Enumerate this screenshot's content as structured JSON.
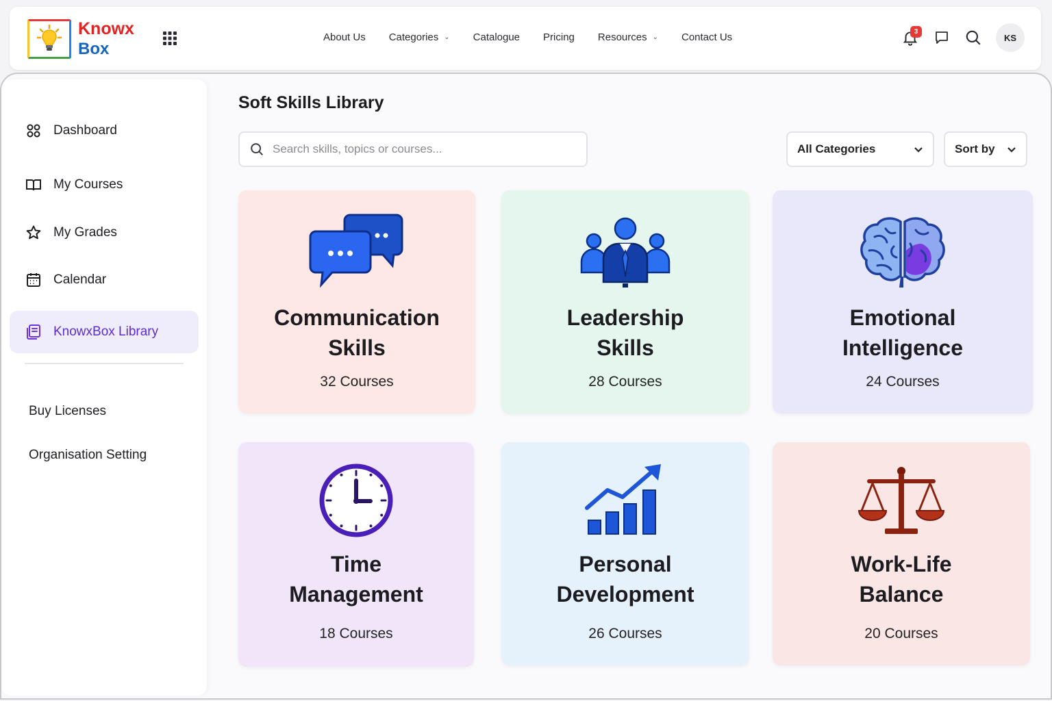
{
  "brand": {
    "name_line1": "Knowx",
    "name_line2": "Box"
  },
  "nav": {
    "items": [
      {
        "label": "About Us",
        "dropdown": false
      },
      {
        "label": "Categories",
        "dropdown": true
      },
      {
        "label": "Catalogue",
        "dropdown": false
      },
      {
        "label": "Pricing",
        "dropdown": false
      },
      {
        "label": "Resources",
        "dropdown": true
      },
      {
        "label": "Contact Us",
        "dropdown": false
      }
    ],
    "notification_count": "3",
    "user_initials": "KS"
  },
  "sidebar": {
    "items": [
      {
        "label": "Dashboard",
        "icon": "dashboard-icon"
      },
      {
        "label": "My Courses",
        "icon": "book-icon"
      },
      {
        "label": "My Grades",
        "icon": "star-icon"
      },
      {
        "label": "Calendar",
        "icon": "calendar-icon"
      },
      {
        "label": "KnowxBox Library",
        "icon": "library-icon",
        "active": true
      }
    ],
    "links": [
      {
        "label": "Buy Licenses"
      },
      {
        "label": "Organisation Setting"
      }
    ]
  },
  "main": {
    "title": "Soft Skills Library",
    "search_placeholder": "Search skills, topics or courses...",
    "category_filter": "All Categories",
    "sort_label": "Sort by",
    "cards": [
      {
        "title_line1": "Communication",
        "title_line2": "Skills",
        "count": "32 Courses",
        "icon": "chat-bubbles-icon",
        "bg": "#fde8e6"
      },
      {
        "title_line1": "Leadership",
        "title_line2": "Skills",
        "count": "28 Courses",
        "icon": "team-leader-icon",
        "bg": "#e4f6ee"
      },
      {
        "title_line1": "Emotional",
        "title_line2": "Intelligence",
        "count": "24 Courses",
        "icon": "brain-icon",
        "bg": "#e9e8fa"
      },
      {
        "title_line1": "Time",
        "title_line2": "Management",
        "count": "18 Courses",
        "icon": "clock-icon",
        "bg": "#f1e6f9"
      },
      {
        "title_line1": "Personal",
        "title_line2": "Development",
        "count": "26 Courses",
        "icon": "growth-chart-icon",
        "bg": "#e5f1fb"
      },
      {
        "title_line1": "Work-Life",
        "title_line2": "Balance",
        "count": "20 Courses",
        "icon": "balance-scale-icon",
        "bg": "#fbe6e6"
      }
    ]
  },
  "colors": {
    "accent": "#5b2bd0",
    "badge": "#e53935",
    "brand_red": "#e32222",
    "brand_blue": "#1565c0"
  }
}
